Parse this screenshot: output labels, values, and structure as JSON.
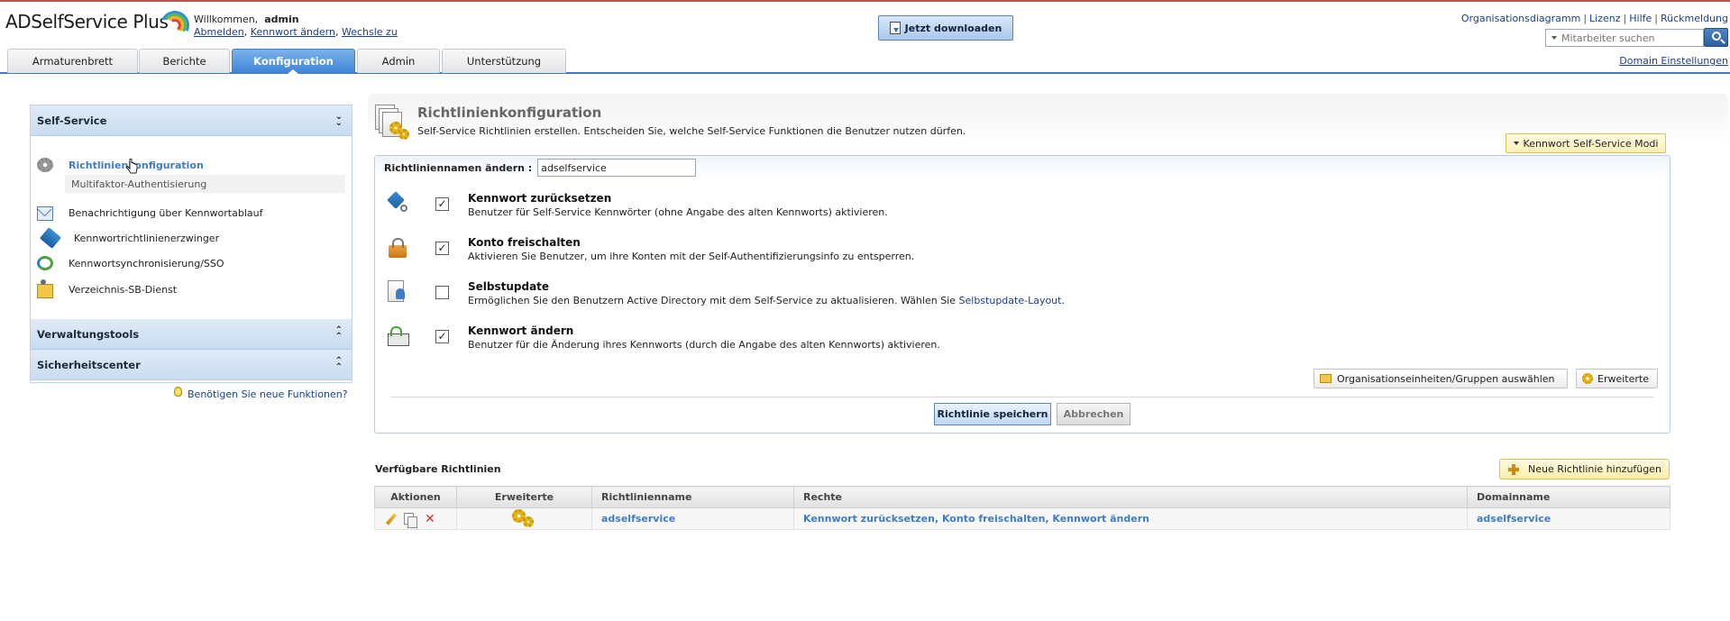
{
  "header": {
    "logo_text": "ADSelfService Plus",
    "welcome_prefix": "Willkommen,",
    "username": "admin",
    "logout_link": "Abmelden",
    "change_password_link": "Kennwort ändern",
    "switch_link": "Wechsle zu",
    "download_button": "Jetzt downloaden",
    "top_links": [
      "Organisationsdiagramm",
      "Lizenz",
      "Hilfe",
      "Rückmeldung"
    ],
    "search_placeholder": "Mitarbeiter suchen",
    "domain_settings_link": "Domain Einstellungen"
  },
  "tabs": [
    {
      "label": "Armaturenbrett",
      "active": false
    },
    {
      "label": "Berichte",
      "active": false
    },
    {
      "label": "Konfiguration",
      "active": true
    },
    {
      "label": "Admin",
      "active": false
    },
    {
      "label": "Unterstützung",
      "active": false
    }
  ],
  "sidebar": {
    "self_service_header": "Self-Service",
    "items": [
      {
        "label": "Richtlinienkonfiguration",
        "icon": "gear-icon",
        "active": true
      },
      {
        "label": "Benachrichtigung über Kennwortablauf",
        "icon": "mail-icon"
      },
      {
        "label": "Kennwortrichtlinienerzwinger",
        "icon": "pen-icon"
      },
      {
        "label": "Kennwortsynchronisierung/SSO",
        "icon": "sync-icon"
      },
      {
        "label": "Verzeichnis-SB-Dienst",
        "icon": "directory-icon"
      }
    ],
    "sub_item": "Multifaktor-Authentisierung",
    "admin_tools_header": "Verwaltungstools",
    "security_center_header": "Sicherheitscenter",
    "new_features_link": "Benötigen Sie neue Funktionen?"
  },
  "main": {
    "title": "Richtlinienkonfiguration",
    "description": "Self-Service Richtlinien erstellen. Entscheiden Sie, welche Self-Service Funktionen die Benutzer nutzen dürfen.",
    "mode_button": "Kennwort Self-Service Modi",
    "policy_name_label": "Richtliniennamen ändern :",
    "policy_name_value": "adselfservice",
    "features": [
      {
        "title": "Kennwort zurücksetzen",
        "desc": "Benutzer für Self-Service Kennwörter (ohne Angabe des alten Kennworts) aktivieren.",
        "checked": true,
        "icon": "reset-password-icon"
      },
      {
        "title": "Konto freischalten",
        "desc": "Aktivieren Sie Benutzer, um ihre Konten mit der Self-Authentifizierungsinfo zu entsperren.",
        "checked": true,
        "icon": "unlock-account-icon"
      },
      {
        "title": "Selbstupdate",
        "desc": "Ermöglichen Sie den Benutzern Active Directory mit dem Self-Service zu aktualisieren. Wählen Sie",
        "desc_link": "Selbstupdate-Layout",
        "desc_suffix": ".",
        "checked": false,
        "icon": "self-update-icon"
      },
      {
        "title": "Kennwort ändern",
        "desc": "Benutzer für die Änderung ihres Kennworts (durch die Angabe des alten Kennworts) aktivieren.",
        "checked": true,
        "icon": "change-password-icon"
      }
    ],
    "ou_groups_button": "Organisationseinheiten/Gruppen auswählen",
    "advanced_button": "Erweiterte",
    "save_button": "Richtlinie speichern",
    "cancel_button": "Abbrechen",
    "check_mark": "✓"
  },
  "available": {
    "title": "Verfügbare Richtlinien",
    "add_button": "Neue Richtlinie hinzufügen",
    "columns": [
      "Aktionen",
      "Erweiterte",
      "Richtlinienname",
      "Rechte",
      "Domainname"
    ],
    "rows": [
      {
        "name": "adselfservice",
        "rights": "Kennwort zurücksetzen, Konto freischalten, Kennwort ändern",
        "domain": "adselfservice"
      }
    ]
  }
}
